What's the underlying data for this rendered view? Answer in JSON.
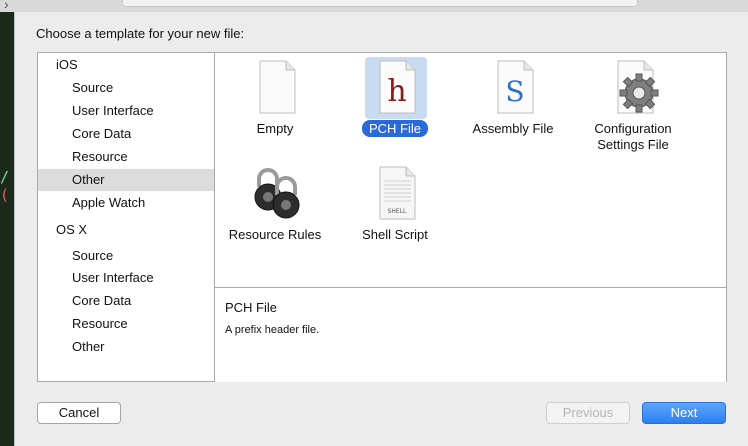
{
  "dialog": {
    "prompt": "Choose a template for your new file:"
  },
  "sidebar": {
    "groups": [
      {
        "label": "iOS",
        "items": [
          "Source",
          "User Interface",
          "Core Data",
          "Resource",
          "Other",
          "Apple Watch"
        ]
      },
      {
        "label": "OS X",
        "items": [
          "Source",
          "User Interface",
          "Core Data",
          "Resource",
          "Other"
        ]
      }
    ],
    "selected": "iOS / Other"
  },
  "templates": [
    {
      "label": "Empty",
      "icon": "blank-document-icon",
      "selected": false
    },
    {
      "label": "PCH File",
      "icon": "pch-h-document-icon",
      "selected": true
    },
    {
      "label": "Assembly File",
      "icon": "assembly-s-document-icon",
      "selected": false
    },
    {
      "label": "Configuration",
      "label2": "Settings File",
      "icon": "config-gear-document-icon",
      "selected": false
    },
    {
      "label": "Resource Rules",
      "icon": "padlocks-icon",
      "selected": false
    },
    {
      "label": "Shell Script",
      "icon": "shell-script-document-icon",
      "selected": false
    }
  ],
  "description": {
    "title": "PCH File",
    "subtitle": "A prefix header file."
  },
  "buttons": {
    "cancel": "Cancel",
    "previous": "Previous",
    "next": "Next"
  },
  "editor": {
    "glyph1": "/",
    "glyph2": "("
  },
  "colors": {
    "accent": "#2a6ad8",
    "selected_tile_bg": "#c9dbf0",
    "pch_h": "#8b1a1a",
    "assembly_s": "#2d6fc9"
  }
}
